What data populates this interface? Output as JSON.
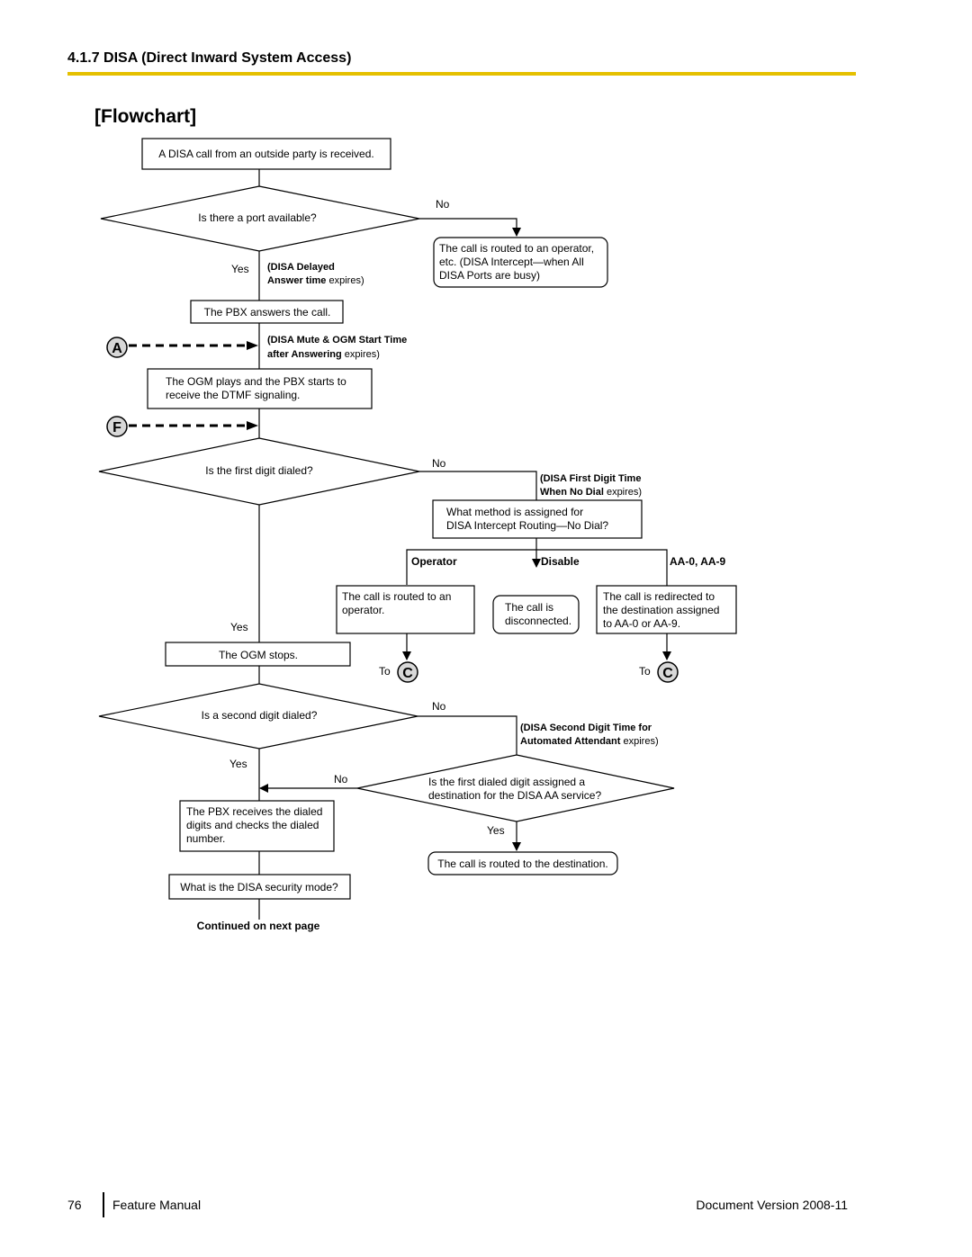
{
  "header": {
    "section_title": "4.1.7 DISA (Direct Inward System Access)",
    "flowchart_heading": "[Flowchart]",
    "accent_color": "#e5c000"
  },
  "flowchart": {
    "start": "A DISA call from an outside party is received.",
    "decision_port": "Is there a port available?",
    "no_label": "No",
    "yes_label": "Yes",
    "port_busy_lines": [
      "The call is routed to an operator,",
      "etc. (DISA Intercept—when All",
      "DISA Ports are busy)"
    ],
    "delayed_answer": {
      "bold1": "(DISA Delayed",
      "bold2": "Answer time",
      "rest": " expires)"
    },
    "pbx_answers": "The PBX answers the call.",
    "connector_a": "A",
    "connector_f": "F",
    "connector_c": "C",
    "to_label": "To",
    "mute_ogm": {
      "bold1": "(DISA Mute & OGM Start Time",
      "bold2": "after Answering",
      "rest": " expires)"
    },
    "ogm_plays_lines": [
      "The OGM plays and the PBX starts to",
      "receive the DTMF signaling."
    ],
    "decision_first_digit": "Is the first digit dialed?",
    "first_digit_time": {
      "bold1": "(DISA First Digit Time",
      "bold2": "When No Dial",
      "rest": " expires)"
    },
    "intercept_method_lines": [
      "What method is assigned for",
      "DISA Intercept Routing—No Dial?"
    ],
    "branch_operator": "Operator",
    "branch_disable": "Disable",
    "branch_aa": "AA-0, AA-9",
    "routed_operator_lines": [
      "The call is routed to an",
      "operator."
    ],
    "disconnected_lines": [
      "The call is",
      "disconnected."
    ],
    "redirected_lines": [
      "The call is redirected to",
      "the destination assigned",
      "to AA-0 or AA-9."
    ],
    "ogm_stops": "The OGM stops.",
    "decision_second_digit": "Is a second digit dialed?",
    "second_digit_time": {
      "bold1": "(DISA Second Digit Time for",
      "bold2": "Automated Attendant",
      "rest": " expires)"
    },
    "decision_aa_lines": [
      "Is the first dialed digit assigned a",
      "destination for the DISA AA service?"
    ],
    "routed_destination": "The call is routed to the destination.",
    "pbx_receives_lines": [
      "The PBX receives the dialed",
      "digits and checks the dialed",
      "number."
    ],
    "security_mode": "What is the DISA security mode?",
    "continued": "Continued on next page"
  },
  "footer": {
    "page_number": "76",
    "manual": "Feature Manual",
    "version": "Document Version  2008-11"
  }
}
